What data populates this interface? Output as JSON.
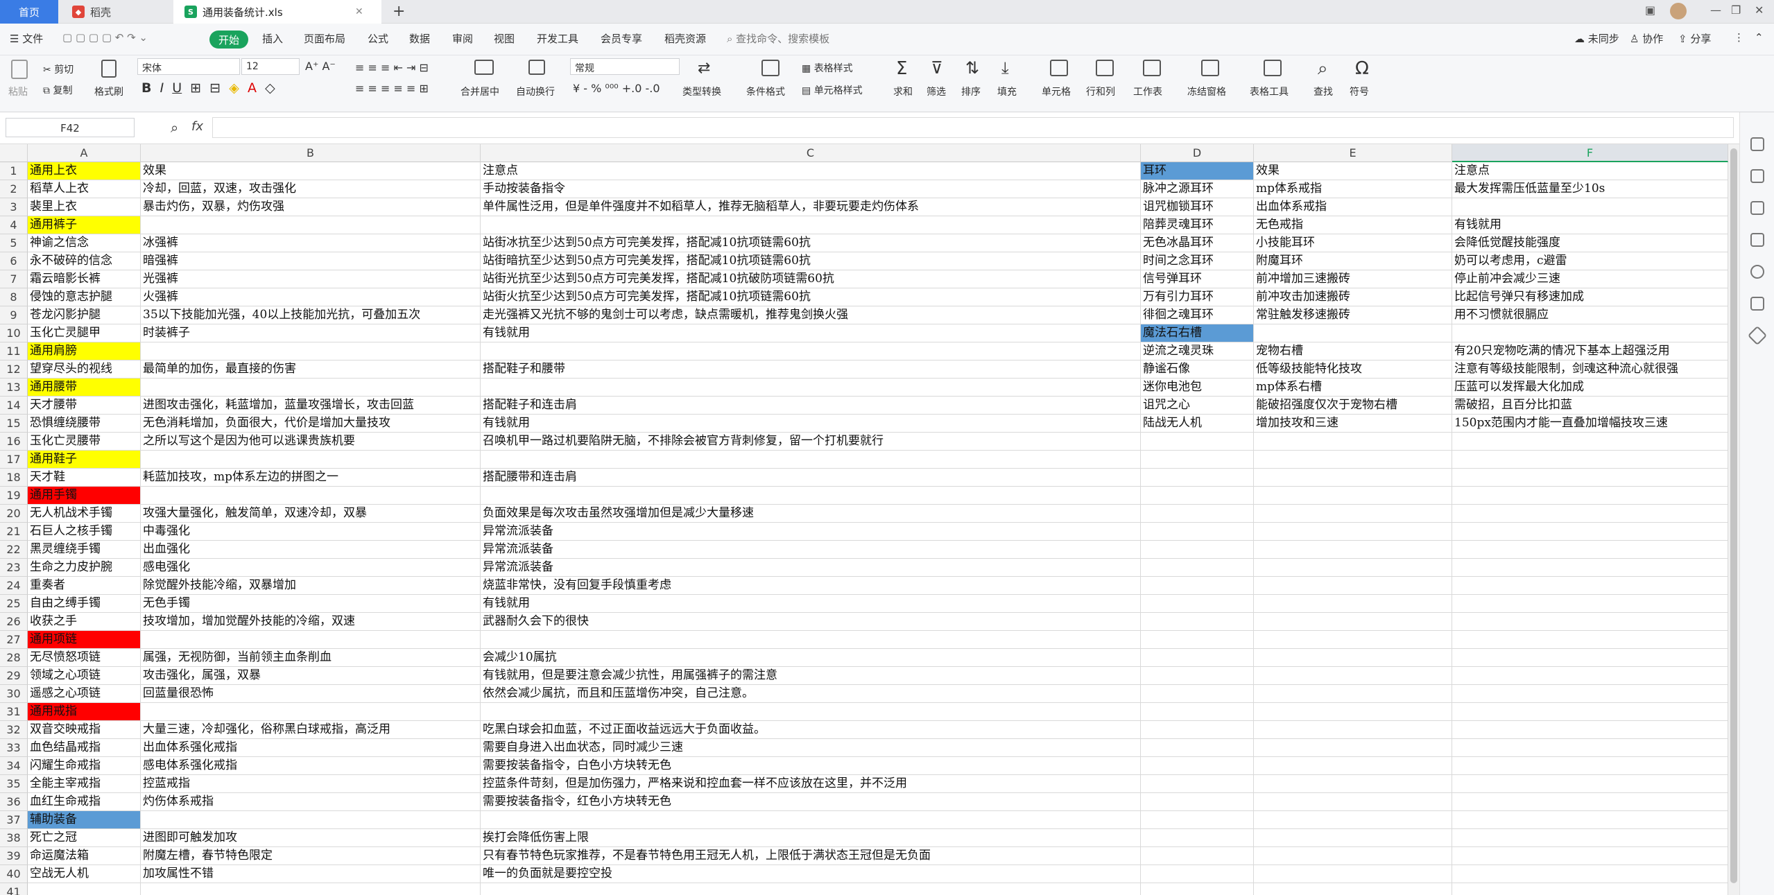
{
  "tabs": {
    "home": "首页",
    "t2": "稻壳",
    "active": "通用装备统计.xls"
  },
  "menu": {
    "file": "文件",
    "start": "开始",
    "items": [
      "插入",
      "页面布局",
      "公式",
      "数据",
      "审阅",
      "视图",
      "开发工具",
      "会员专享",
      "稻壳资源"
    ],
    "search": "查找命令、搜索模板",
    "sync": "未同步",
    "collab": "协作",
    "share": "分享"
  },
  "toolbar": {
    "paste": "粘贴",
    "cut": "剪切",
    "copy": "复制",
    "format_painter": "格式刷",
    "font": "宋体",
    "size": "12",
    "merge": "合并居中",
    "wrap": "自动换行",
    "numfmt": "常规",
    "convert": "类型转换",
    "cond": "条件格式",
    "table_style": "表格样式",
    "cell_style": "单元格样式",
    "sum": "求和",
    "filter": "筛选",
    "sort": "排序",
    "fill": "填充",
    "cell": "单元格",
    "rowcol": "行和列",
    "sheet": "工作表",
    "freeze": "冻结窗格",
    "tabletools": "表格工具",
    "find": "查找",
    "symbol": "符号"
  },
  "formula": {
    "namebox": "F42",
    "fx": "fx"
  },
  "columns": [
    "A",
    "B",
    "C",
    "D",
    "E",
    "F"
  ],
  "rows": [
    [
      "通用上衣",
      "效果",
      "注意点",
      "耳环",
      "效果",
      "注意点"
    ],
    [
      "稻草人上衣",
      "冷却，回蓝，双速，攻击强化",
      "手动按装备指令",
      "脉冲之源耳环",
      "mp体系戒指",
      "最大发挥需压低蓝量至少10s"
    ],
    [
      "裴里上衣",
      "暴击灼伤，双暴，灼伤攻强",
      "单件属性泛用，但是单件强度并不如稻草人，推荐无脑稻草人，非要玩要走灼伤体系",
      "诅咒枷锁耳环",
      "出血体系戒指",
      ""
    ],
    [
      "通用裤子",
      "",
      "",
      "陪葬灵魂耳环",
      "无色戒指",
      "有钱就用"
    ],
    [
      "神谕之信念",
      "冰强裤",
      "站街冰抗至少达到50点方可完美发挥，搭配减10抗项链需60抗",
      "无色冰晶耳环",
      "小技能耳环",
      "会降低觉醒技能强度"
    ],
    [
      "永不破碎的信念",
      "暗强裤",
      "站街暗抗至少达到50点方可完美发挥，搭配减10抗项链需60抗",
      "时间之念耳环",
      "附魔耳环",
      "奶可以考虑用，c避雷"
    ],
    [
      "霜云暗影长裤",
      "光强裤",
      "站街光抗至少达到50点方可完美发挥，搭配减10抗破防项链需60抗",
      "信号弹耳环",
      "前冲增加三速搬砖",
      "停止前冲会减少三速"
    ],
    [
      "侵蚀的意志护腿",
      "火强裤",
      "站街火抗至少达到50点方可完美发挥，搭配减10抗项链需60抗",
      "万有引力耳环",
      "前冲攻击加速搬砖",
      "比起信号弹只有移速加成"
    ],
    [
      "苍龙闪影护腿",
      "35以下技能加光强，40以上技能加光抗，可叠加五次",
      "走光强裤又光抗不够的鬼剑士可以考虑，缺点需暖机，推荐鬼剑换火强",
      "徘徊之魂耳环",
      "常驻触发移速搬砖",
      "用不习惯就很膈应"
    ],
    [
      "玉化亡灵腿甲",
      "时装裤子",
      "有钱就用",
      "魔法石右槽",
      "",
      ""
    ],
    [
      "通用肩膀",
      "",
      "",
      "逆流之魂灵珠",
      "宠物右槽",
      "有20只宠物吃满的情况下基本上超强泛用"
    ],
    [
      "望穿尽头的视线",
      "最简单的加伤，最直接的伤害",
      "搭配鞋子和腰带",
      "静谧石像",
      "低等级技能特化技攻",
      "注意有等级技能限制，剑魂这种流心就很强"
    ],
    [
      "通用腰带",
      "",
      "",
      "迷你电池包",
      "mp体系右槽",
      "压蓝可以发挥最大化加成"
    ],
    [
      "天才腰带",
      "进图攻击强化，耗蓝增加，蓝量攻强增长，攻击回蓝",
      "搭配鞋子和连击肩",
      "诅咒之心",
      "能破招强度仅次于宠物右槽",
      "需破招，且百分比扣蓝"
    ],
    [
      "恐惧缠绕腰带",
      "无色消耗增加，负面很大，代价是增加大量技攻",
      "有钱就用",
      "陆战无人机",
      "增加技攻和三速",
      "150px范围内才能一直叠加增幅技攻三速"
    ],
    [
      "玉化亡灵腰带",
      "之所以写这个是因为他可以逃课贵族机要",
      "召唤机甲一路过机要陷阱无脑，不排除会被官方背刺修复，留一个打机要就行",
      "",
      "",
      ""
    ],
    [
      "通用鞋子",
      "",
      "",
      "",
      "",
      ""
    ],
    [
      "天才鞋",
      "耗蓝加技攻，mp体系左边的拼图之一",
      "搭配腰带和连击肩",
      "",
      "",
      ""
    ],
    [
      "通用手镯",
      "",
      "",
      "",
      "",
      ""
    ],
    [
      "无人机战术手镯",
      "攻强大量强化，触发简单，双速冷却，双暴",
      "负面效果是每次攻击虽然攻强增加但是减少大量移速",
      "",
      "",
      ""
    ],
    [
      "石巨人之核手镯",
      "中毒强化",
      "异常流派装备",
      "",
      "",
      ""
    ],
    [
      "黑灵缠绕手镯",
      "出血强化",
      "异常流派装备",
      "",
      "",
      ""
    ],
    [
      "生命之力皮护腕",
      "感电强化",
      "异常流派装备",
      "",
      "",
      ""
    ],
    [
      "重奏者",
      "除觉醒外技能冷缩，双暴增加",
      "烧蓝非常快，没有回复手段慎重考虑",
      "",
      "",
      ""
    ],
    [
      "自由之缚手镯",
      "无色手镯",
      "有钱就用",
      "",
      "",
      ""
    ],
    [
      "收获之手",
      "技攻增加，增加觉醒外技能的冷缩，双速",
      "武器耐久会下的很快",
      "",
      "",
      ""
    ],
    [
      "通用项链",
      "",
      "",
      "",
      "",
      ""
    ],
    [
      "无尽愤怒项链",
      "属强，无视防御，当前领主血条削血",
      "会减少10属抗",
      "",
      "",
      ""
    ],
    [
      "领域之心项链",
      "攻击强化，属强，双暴",
      "有钱就用，但是要注意会减少抗性，用属强裤子的需注意",
      "",
      "",
      ""
    ],
    [
      "遥感之心项链",
      "回蓝量很恐怖",
      "依然会减少属抗，而且和压蓝增伤冲突，自己注意。",
      "",
      "",
      ""
    ],
    [
      "通用戒指",
      "",
      "",
      "",
      "",
      ""
    ],
    [
      "双音交映戒指",
      "大量三速，冷却强化，俗称黑白球戒指，高泛用",
      "吃黑白球会扣血蓝，不过正面收益远远大于负面收益。",
      "",
      "",
      ""
    ],
    [
      "血色结晶戒指",
      "出血体系强化戒指",
      "需要自身进入出血状态，同时减少三速",
      "",
      "",
      ""
    ],
    [
      "闪耀生命戒指",
      "感电体系强化戒指",
      "需要按装备指令，白色小方块转无色",
      "",
      "",
      ""
    ],
    [
      "全能主宰戒指",
      "控蓝戒指",
      "控蓝条件苛刻，但是加伤强力，严格来说和控血套一样不应该放在这里，并不泛用",
      "",
      "",
      ""
    ],
    [
      "血红生命戒指",
      "灼伤体系戒指",
      "需要按装备指令，红色小方块转无色",
      "",
      "",
      ""
    ],
    [
      "辅助装备",
      "",
      "",
      "",
      "",
      ""
    ],
    [
      "死亡之冠",
      "进图即可触发加攻",
      "挨打会降低伤害上限",
      "",
      "",
      ""
    ],
    [
      "命运魔法箱",
      "附魔左槽，春节特色限定",
      "只有春节特色玩家推荐，不是春节特色用王冠无人机，上限低于满状态王冠但是无负面",
      "",
      "",
      ""
    ],
    [
      "空战无人机",
      "加攻属性不错",
      "唯一的负面就是要控空投",
      "",
      "",
      ""
    ],
    [
      "",
      "",
      "",
      "",
      "",
      ""
    ]
  ],
  "fills": {
    "yellow": "#ffff00",
    "red": "#ff0000",
    "blue": "#5b9bd5"
  },
  "fill_rows": {
    "yellow": [
      1,
      4,
      11,
      13,
      17
    ],
    "red": [
      19,
      27,
      31
    ],
    "blue": [
      37
    ]
  },
  "fill_cells_blue_D": [
    1,
    10
  ]
}
